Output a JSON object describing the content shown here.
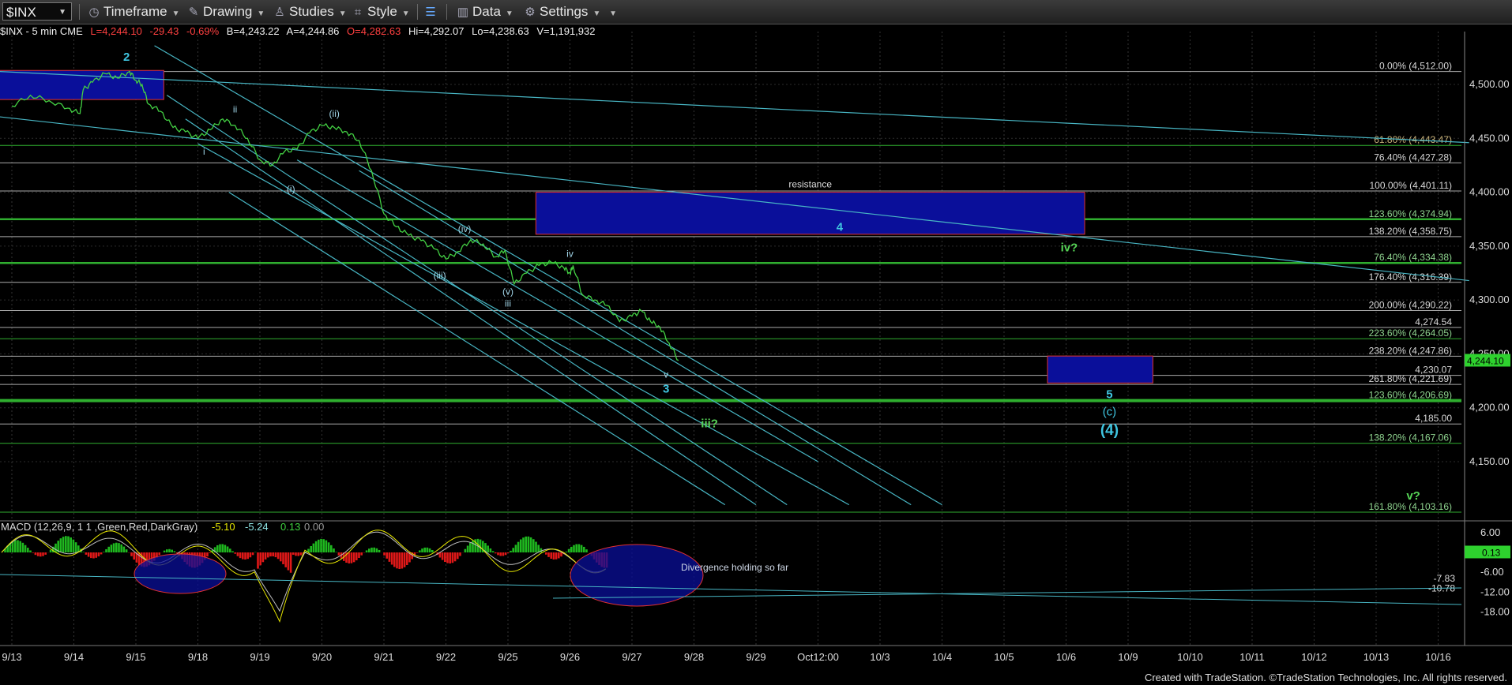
{
  "toolbar": {
    "symbol": "$INX",
    "timeframe": "Timeframe",
    "drawing": "Drawing",
    "studies": "Studies",
    "style": "Style",
    "data": "Data",
    "settings": "Settings"
  },
  "infobar": {
    "symbol": "$INX - 5 min  CME",
    "last": "L=4,244.10",
    "net": "-29.43",
    "pct": "-0.69%",
    "bid": "B=4,243.22",
    "ask": "A=4,244.86",
    "open": "O=4,282.63",
    "high": "Hi=4,292.07",
    "low": "Lo=4,238.63",
    "volume": "V=1,191,932"
  },
  "macd": {
    "label": "MACD (12,26,9, 1   1 ,Green,Red,DarkGray)",
    "v1": "-5.10",
    "v2": "-5.24",
    "v3": "0.13",
    "v4": "0.00",
    "note": "Divergence holding so far",
    "axis_labels": [
      "6.00",
      "-6.00",
      "-12.00",
      "-18.00"
    ],
    "side_labels": [
      "-7.83",
      "-10.78"
    ],
    "current_tag": "0.13"
  },
  "footer": "Created with TradeStation. ©TradeStation Technologies, Inc. All rights reserved.",
  "chart_data": {
    "type": "line",
    "title": "$INX - 5 min",
    "x_categories": [
      "9/13",
      "9/14",
      "9/15",
      "9/18",
      "9/19",
      "9/20",
      "9/21",
      "9/22",
      "9/25",
      "9/26",
      "9/27",
      "9/28",
      "9/29",
      "Oct12:00",
      "10/3",
      "10/4",
      "10/5",
      "10/6",
      "10/9",
      "10/10",
      "10/11",
      "10/12",
      "10/13",
      "10/16"
    ],
    "ylim": [
      4100,
      4540
    ],
    "y_ticks": [
      "4,500.00",
      "4,450.00",
      "4,400.00",
      "4,350.00",
      "4,300.00",
      "4,250.00",
      "4,200.00",
      "4,150.00"
    ],
    "last_price_tag": "4,244.10",
    "series": [
      {
        "points": [
          [
            0,
            4480
          ],
          [
            0.3,
            4490
          ],
          [
            0.6,
            4485
          ],
          [
            0.9,
            4478
          ],
          [
            1.1,
            4473
          ],
          [
            1.15,
            4495
          ],
          [
            1.3,
            4502
          ],
          [
            1.5,
            4510
          ],
          [
            1.7,
            4506
          ],
          [
            1.9,
            4512
          ],
          [
            2.0,
            4504
          ],
          [
            2.1,
            4500
          ],
          [
            2.2,
            4482
          ],
          [
            2.4,
            4475
          ],
          [
            2.6,
            4460
          ],
          [
            2.8,
            4456
          ],
          [
            3.0,
            4450
          ],
          [
            3.2,
            4458
          ],
          [
            3.4,
            4468
          ],
          [
            3.6,
            4462
          ],
          [
            3.8,
            4450
          ],
          [
            4.0,
            4430
          ],
          [
            4.2,
            4425
          ],
          [
            4.4,
            4438
          ],
          [
            4.6,
            4440
          ],
          [
            4.8,
            4455
          ],
          [
            5.0,
            4462
          ],
          [
            5.2,
            4460
          ],
          [
            5.4,
            4456
          ],
          [
            5.6,
            4448
          ],
          [
            5.8,
            4420
          ],
          [
            6.0,
            4380
          ],
          [
            6.2,
            4368
          ],
          [
            6.4,
            4360
          ],
          [
            6.6,
            4355
          ],
          [
            6.8,
            4348
          ],
          [
            7.0,
            4338
          ],
          [
            7.2,
            4345
          ],
          [
            7.4,
            4356
          ],
          [
            7.6,
            4352
          ],
          [
            7.8,
            4340
          ],
          [
            7.95,
            4346
          ],
          [
            8.1,
            4315
          ],
          [
            8.3,
            4325
          ],
          [
            8.5,
            4332
          ],
          [
            8.7,
            4335
          ],
          [
            8.9,
            4330
          ],
          [
            9.0,
            4325
          ],
          [
            9.05,
            4332
          ],
          [
            9.2,
            4305
          ],
          [
            9.4,
            4300
          ],
          [
            9.6,
            4295
          ],
          [
            9.8,
            4280
          ],
          [
            10.0,
            4285
          ],
          [
            10.15,
            4290
          ],
          [
            10.3,
            4280
          ],
          [
            10.45,
            4275
          ],
          [
            10.6,
            4260
          ],
          [
            10.75,
            4244
          ]
        ]
      }
    ],
    "horizontal_levels": [
      {
        "label": "0.00% (4,512.00)",
        "value": 4512
      },
      {
        "label": "61.80% (4,443.47)",
        "value": 4443.47
      },
      {
        "label": "76.40% (4,427.28)",
        "value": 4427.28
      },
      {
        "label": "100.00% (4,401.11)",
        "value": 4401.11
      },
      {
        "label": "123.60% (4,374.94)",
        "value": 4374.94
      },
      {
        "label": "138.20% (4,358.75)",
        "value": 4358.75
      },
      {
        "label": "76.40% (4,334.38)",
        "value": 4334.38
      },
      {
        "label": "176.40% (4,316.39)",
        "value": 4316.39
      },
      {
        "label": "200.00% (4,290.22)",
        "value": 4290.22
      },
      {
        "label": "4,274.54",
        "value": 4274.54
      },
      {
        "label": "223.60% (4,264.05)",
        "value": 4264.05
      },
      {
        "label": "238.20% (4,247.86)",
        "value": 4247.86
      },
      {
        "label": "4,230.07",
        "value": 4230.07
      },
      {
        "label": "261.80% (4,221.69)",
        "value": 4221.69
      },
      {
        "label": "123.60% (4,206.69)",
        "value": 4206.69
      },
      {
        "label": "4,185.00",
        "value": 4185.0
      },
      {
        "label": "138.20% (4,167.06)",
        "value": 4167.06
      },
      {
        "label": "161.80% (4,103.16)",
        "value": 4103.16
      }
    ],
    "zones": [
      {
        "label": "",
        "x0": -0.2,
        "x1": 2.45,
        "y0": 4486,
        "y1": 4513
      },
      {
        "label": "resistance",
        "x0": 8.45,
        "x1": 17.3,
        "y0": 4361,
        "y1": 4400
      },
      {
        "label": "",
        "x0": 16.7,
        "x1": 18.4,
        "y0": 4223,
        "y1": 4248
      }
    ],
    "wave_labels": [
      {
        "text": "2",
        "x": 1.85,
        "y": 4522
      },
      {
        "text": "i",
        "x": 3.1,
        "y": 4435
      },
      {
        "text": "ii",
        "x": 3.6,
        "y": 4474
      },
      {
        "text": "(i)",
        "x": 4.5,
        "y": 4400
      },
      {
        "text": "(ii)",
        "x": 5.2,
        "y": 4470
      },
      {
        "text": "(iii)",
        "x": 6.9,
        "y": 4320
      },
      {
        "text": "(iv)",
        "x": 7.3,
        "y": 4363
      },
      {
        "text": "(v)",
        "x": 8.0,
        "y": 4305
      },
      {
        "text": "iii",
        "x": 8.0,
        "y": 4294
      },
      {
        "text": "iv",
        "x": 9.0,
        "y": 4340
      },
      {
        "text": "v",
        "x": 10.55,
        "y": 4228
      },
      {
        "text": "3",
        "x": 10.55,
        "y": 4214
      },
      {
        "text": "iii?",
        "x": 11.25,
        "y": 4182
      },
      {
        "text": "4",
        "x": 13.35,
        "y": 4364
      },
      {
        "text": "iv?",
        "x": 17.05,
        "y": 4345
      },
      {
        "text": "5",
        "x": 17.7,
        "y": 4209
      },
      {
        "text": "(c)",
        "x": 17.7,
        "y": 4193
      },
      {
        "text": "(4)",
        "x": 17.7,
        "y": 4175
      },
      {
        "text": "v?",
        "x": 22.6,
        "y": 4115
      }
    ]
  }
}
